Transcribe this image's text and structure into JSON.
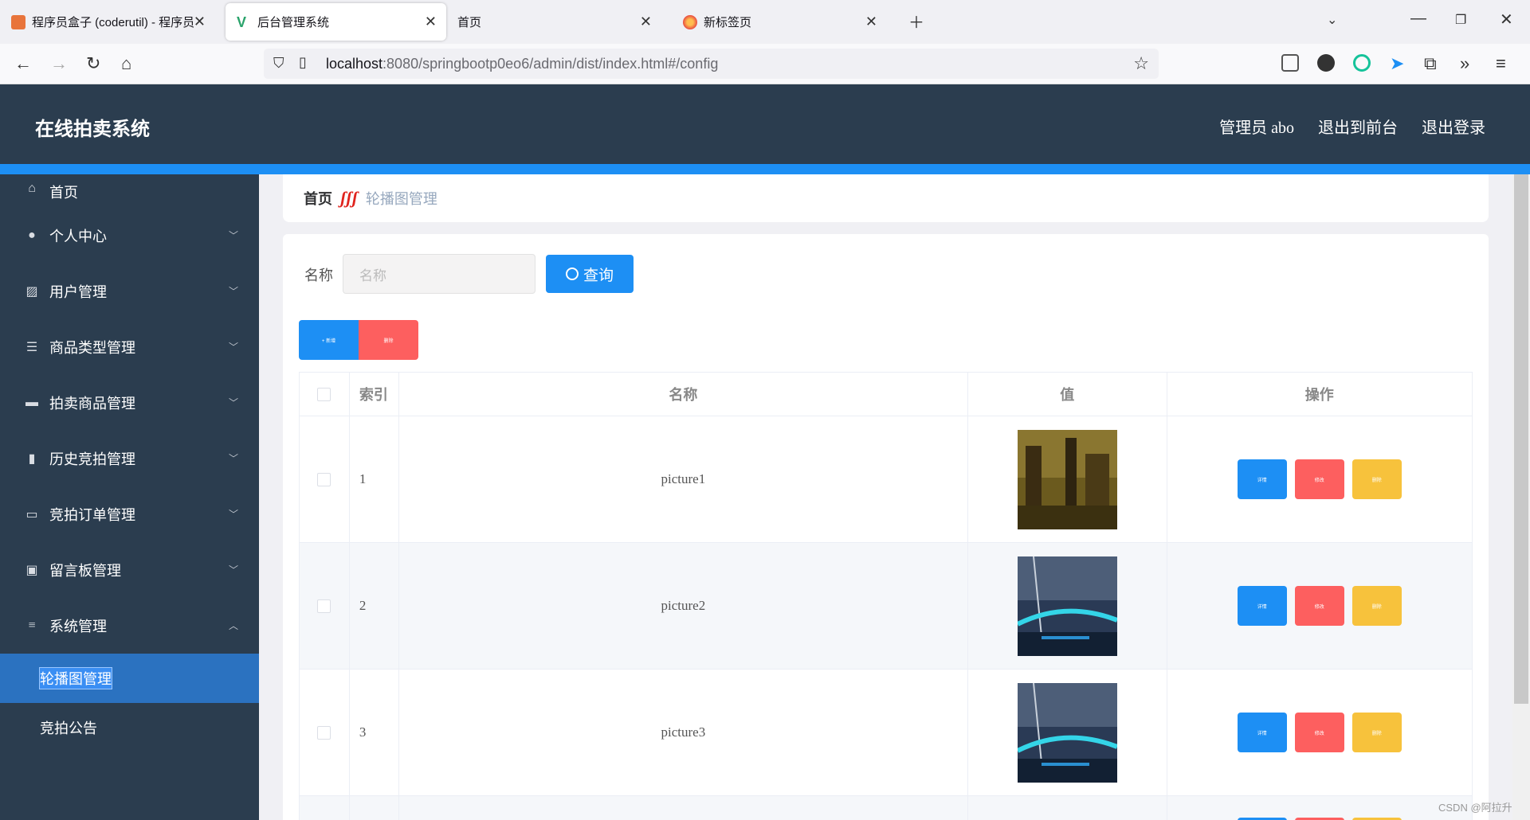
{
  "browser": {
    "tabs": [
      {
        "label": "程序员盒子 (coderutil) - 程序员",
        "icon": "box-icon"
      },
      {
        "label": "后台管理系统",
        "icon": "vue-icon"
      },
      {
        "label": "首页",
        "icon": ""
      },
      {
        "label": "新标签页",
        "icon": "firefox-icon"
      }
    ],
    "url_host": "localhost",
    "url_rest": ":8080/springbootp0eo6/admin/dist/index.html#/config"
  },
  "header": {
    "title": "在线拍卖系统",
    "user": "管理员 abo",
    "to_front": "退出到前台",
    "logout": "退出登录"
  },
  "sidebar": {
    "items": [
      {
        "label": "首页",
        "icon": "home-icon"
      },
      {
        "label": "个人中心",
        "icon": "user-icon"
      },
      {
        "label": "用户管理",
        "icon": "chart-icon"
      },
      {
        "label": "商品类型管理",
        "icon": "sliders-icon"
      },
      {
        "label": "拍卖商品管理",
        "icon": "ticket-icon"
      },
      {
        "label": "历史竞拍管理",
        "icon": "book-icon"
      },
      {
        "label": "竞拍订单管理",
        "icon": "message-icon"
      },
      {
        "label": "留言板管理",
        "icon": "briefcase-icon"
      },
      {
        "label": "系统管理",
        "icon": "menu-icon"
      }
    ],
    "sub_items": [
      {
        "label": "轮播图管理"
      },
      {
        "label": "竞拍公告"
      }
    ]
  },
  "breadcrumb": {
    "home": "首页",
    "separator": "ʃʃʃ",
    "current": "轮播图管理"
  },
  "search": {
    "label": "名称",
    "placeholder": "名称",
    "button": "查询"
  },
  "actions": {
    "add": "+ 新增",
    "delete": "删除"
  },
  "table": {
    "headers": [
      "索引",
      "名称",
      "值",
      "操作"
    ],
    "rows": [
      {
        "index": "1",
        "name": "picture1"
      },
      {
        "index": "2",
        "name": "picture2"
      },
      {
        "index": "3",
        "name": "picture3"
      }
    ],
    "op_labels": {
      "detail": "详情",
      "edit": "修改",
      "delete": "删除"
    }
  },
  "watermark": "CSDN @阿拉升"
}
